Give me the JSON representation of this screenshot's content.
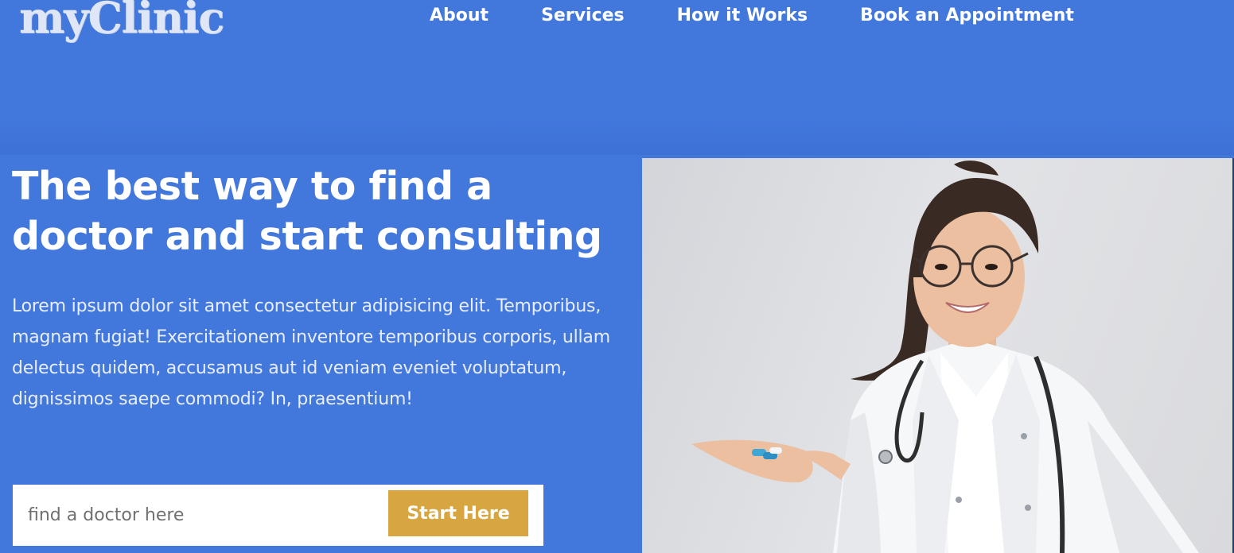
{
  "header": {
    "logo": "myClinic",
    "nav": [
      {
        "label": "About"
      },
      {
        "label": "Services"
      },
      {
        "label": "How it Works"
      },
      {
        "label": "Book an Appointment"
      }
    ]
  },
  "hero": {
    "title": "The best way to find a doctor and start consulting",
    "description": "Lorem ipsum dolor sit amet consectetur adipisicing elit. Temporibus, magnam fugiat! Exercitationem inventore temporibus corporis, ullam delectus quidem, accusamus aut id veniam eveniet voluptatum, dignissimos saepe commodi? In, praesentium!",
    "search": {
      "placeholder": "find a doctor here",
      "value": ""
    },
    "cta_label": "Start Here",
    "image": "doctor-photo"
  },
  "colors": {
    "background": "#4277dc",
    "accent": "#d8a641",
    "text": "#ffffff"
  }
}
